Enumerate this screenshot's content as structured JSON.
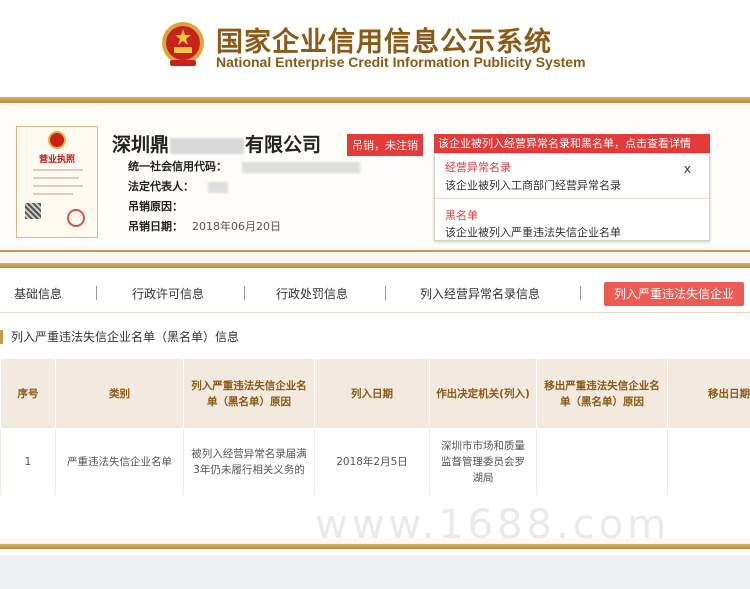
{
  "header": {
    "title_cn": "国家企业信用信息公示系统",
    "title_en": "National Enterprise Credit Information Publicity System"
  },
  "license": {
    "title": "营业执照"
  },
  "company": {
    "name_prefix": "深圳鼎",
    "name_suffix": "有限公司",
    "status_badge": "吊销，未注销",
    "alert_banner": "该企业被列入经营异常名录和黑名单，点击查看详情",
    "fields": {
      "credit_code_label": "统一社会信用代码：",
      "legal_rep_label": "法定代表人：",
      "revoke_reason_label": "吊销原因：",
      "revoke_date_label": "吊销日期：",
      "revoke_date_value": "2018年06月20日"
    }
  },
  "popup": {
    "abnormal_title": "经营异常名录",
    "abnormal_text": "该企业被列入工商部门经营异常名录",
    "blacklist_title": "黑名单",
    "blacklist_text": "该企业被列入严重违法失信企业名单",
    "close": "x"
  },
  "tabs": [
    {
      "label": "基础信息"
    },
    {
      "label": "行政许可信息"
    },
    {
      "label": "行政处罚信息"
    },
    {
      "label": "列入经营异常名录信息"
    },
    {
      "label": "列入严重违法失信企业"
    }
  ],
  "section": {
    "title": "列入严重违法失信企业名单（黑名单）信息"
  },
  "table": {
    "headers": [
      "序号",
      "类别",
      "列入严重违法失信企业名单（黑名单）原因",
      "列入日期",
      "作出决定机关(列入)",
      "移出严重违法失信企业名单（黑名单）原因",
      "移出日期"
    ],
    "rows": [
      [
        "1",
        "严重违法失信企业名单",
        "被列入经营异常名录届满3年仍未履行相关义务的",
        "2018年2月5日",
        "深圳市市场和质量监督管理委员会罗湖局",
        "",
        ""
      ]
    ]
  },
  "watermark": "www.1688.com",
  "colors": {
    "gold": "#c89a4a",
    "brand_brown": "#8a5a16",
    "alert_red": "#e33a3a",
    "tab_active": "#ec5b54"
  }
}
